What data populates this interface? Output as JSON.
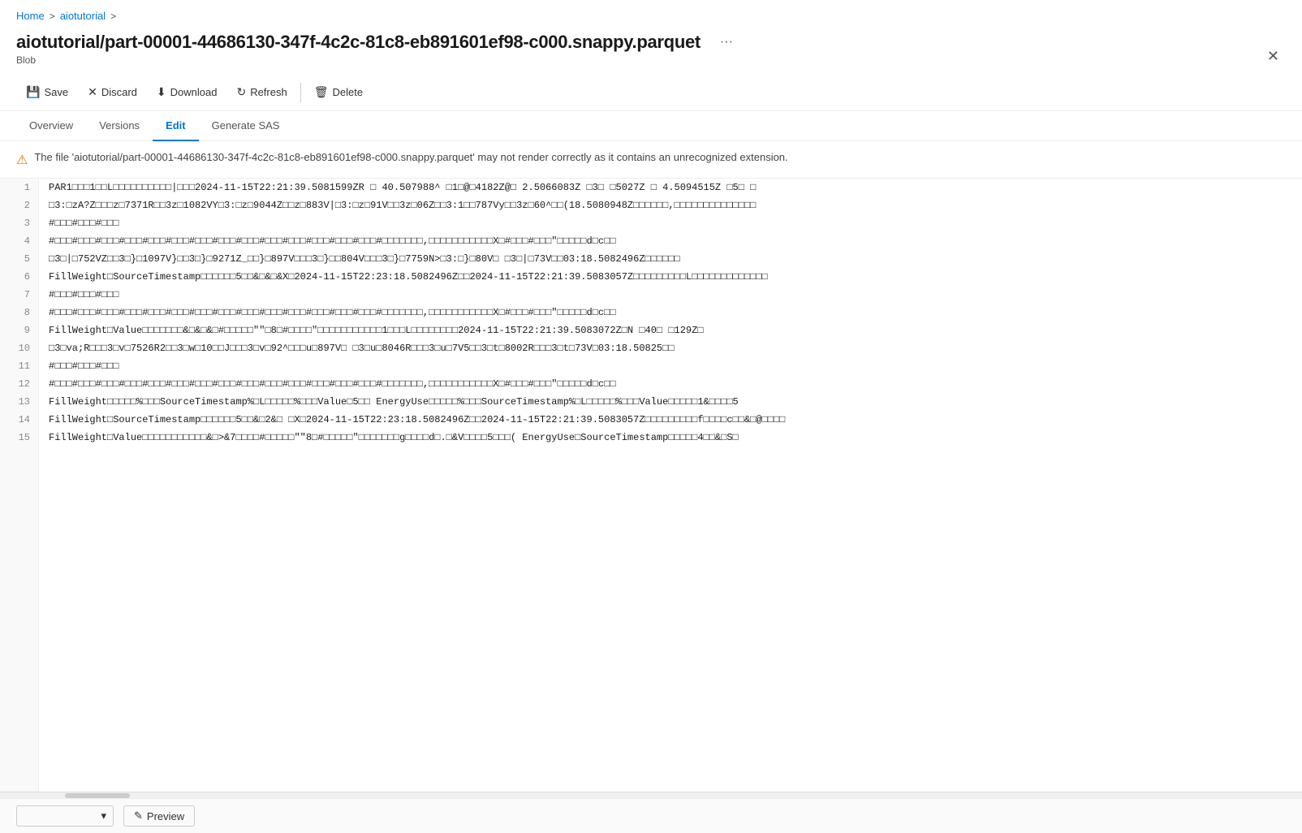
{
  "breadcrumb": {
    "home": "Home",
    "sep1": ">",
    "tutorial": "aiotutorial",
    "sep2": ">"
  },
  "file": {
    "title": "aiotutorial/part-00001-44686130-347f-4c2c-81c8-eb891601ef98-c000.snappy.parquet",
    "subtitle": "Blob"
  },
  "toolbar": {
    "save": "Save",
    "discard": "Discard",
    "download": "Download",
    "refresh": "Refresh",
    "delete": "Delete"
  },
  "tabs": [
    {
      "label": "Overview",
      "active": false
    },
    {
      "label": "Versions",
      "active": false
    },
    {
      "label": "Edit",
      "active": true
    },
    {
      "label": "Generate SAS",
      "active": false
    }
  ],
  "warning": {
    "text": "The file 'aiotutorial/part-00001-44686130-347f-4c2c-81c8-eb891601ef98-c000.snappy.parquet' may not render correctly as it contains an unrecognized extension."
  },
  "lines": [
    {
      "num": 1,
      "content": "PAR1□□□1□□L□□□□□□□□□□|□□□2024-11-15T22:21:39.5081599ZR □ 40.507988^ □1□@□4182Z@□ 2.5066083Z □3□ □5027Z □ 4.5094515Z □5□ □"
    },
    {
      "num": 2,
      "content": "□3:□zA?Z□□□z□7371R□□3z□1082VY□3:□z□9044Z□□z□883V|□3:□z□91V□□3z□06Z□□3:1□□787Vy□□3z□60^□□(18.5080948Z□□□□□□,□□□□□□□□□□□□□□"
    },
    {
      "num": 3,
      "content": "#□□□#□□□#□□□"
    },
    {
      "num": 4,
      "content": "#□□□#□□□#□□□#□□□#□□□#□□□#□□□#□□□#□□□#□□□#□□□#□□□#□□□#□□□#□□□□□□□,□□□□□□□□□□□X□#□□□#□□□\"□□□□□d□c□□"
    },
    {
      "num": 5,
      "content": "□3□|□752VZ□□3□}□1097V}□□3□}□9271Z_□□}□897V□□□3□}□□804V□□□3□}□7759N>□3:□}□80V□   □3□|□73V□□03:18.5082496Z□□□□□□"
    },
    {
      "num": 6,
      "content": "FillWeight□SourceTimestamp□□□□□□5□□&□&□&X□2024-11-15T22:23:18.5082496Z□□2024-11-15T22:21:39.5083057Z□□□□□□□□□L□□□□□□□□□□□□□"
    },
    {
      "num": 7,
      "content": "#□□□#□□□#□□□"
    },
    {
      "num": 8,
      "content": "#□□□#□□□#□□□#□□□#□□□#□□□#□□□#□□□#□□□#□□□#□□□#□□□#□□□#□□□#□□□□□□□,□□□□□□□□□□□X□#□□□#□□□\"□□□□□d□c□□"
    },
    {
      "num": 9,
      "content": "FillWeight□Value□□□□□□□&□&□&□#□□□□□\"\"□8□#□□□□\"□□□□□□□□□□□1□□□L□□□□□□□□2024-11-15T22:21:39.5083072Z□N □40□ □129Z□"
    },
    {
      "num": 10,
      "content": "□3□va;R□□□3□v□7526R2□□3□w□10□□J□□□3□v□92^□□□u□897V□  □3□u□8046R□□□3□u□7V5□□3□t□8002R□□□3□t□73V□03:18.50825□□"
    },
    {
      "num": 11,
      "content": "#□□□#□□□#□□□"
    },
    {
      "num": 12,
      "content": "#□□□#□□□#□□□#□□□#□□□#□□□#□□□#□□□#□□□#□□□#□□□#□□□#□□□#□□□#□□□□□□□,□□□□□□□□□□□X□#□□□#□□□\"□□□□□d□c□□"
    },
    {
      "num": 13,
      "content": "FillWeight□□□□□%□□□SourceTimestamp%□L□□□□□%□□□Value□5□□    EnergyUse□□□□□%□□□SourceTimestamp%□L□□□□□%□□□Value□□□□□1&□□□□5"
    },
    {
      "num": 14,
      "content": "FillWeight□SourceTimestamp□□□□□□5□□&□2&□ □X□2024-11-15T22:23:18.5082496Z□□2024-11-15T22:21:39.5083057Z□□□□□□□□□f□□□□c□□&□@□□□□"
    },
    {
      "num": 15,
      "content": "FillWeight□Value□□□□□□□□□□□&□>&7□□□□#□□□□□\"\"8□#□□□□□\"□□□□□□□g□□□□d□.□&V□□□□5□□□(  EnergyUse□SourceTimestamp□□□□□4□□&□S□"
    }
  ],
  "bottom": {
    "encoding_placeholder": "",
    "chevron_label": "▾",
    "preview_label": "Preview",
    "pencil_icon": "✎"
  },
  "colors": {
    "accent": "#0078d4",
    "warning": "#d97706",
    "border": "#ededed",
    "line_num_bg": "#f9f9f9"
  }
}
